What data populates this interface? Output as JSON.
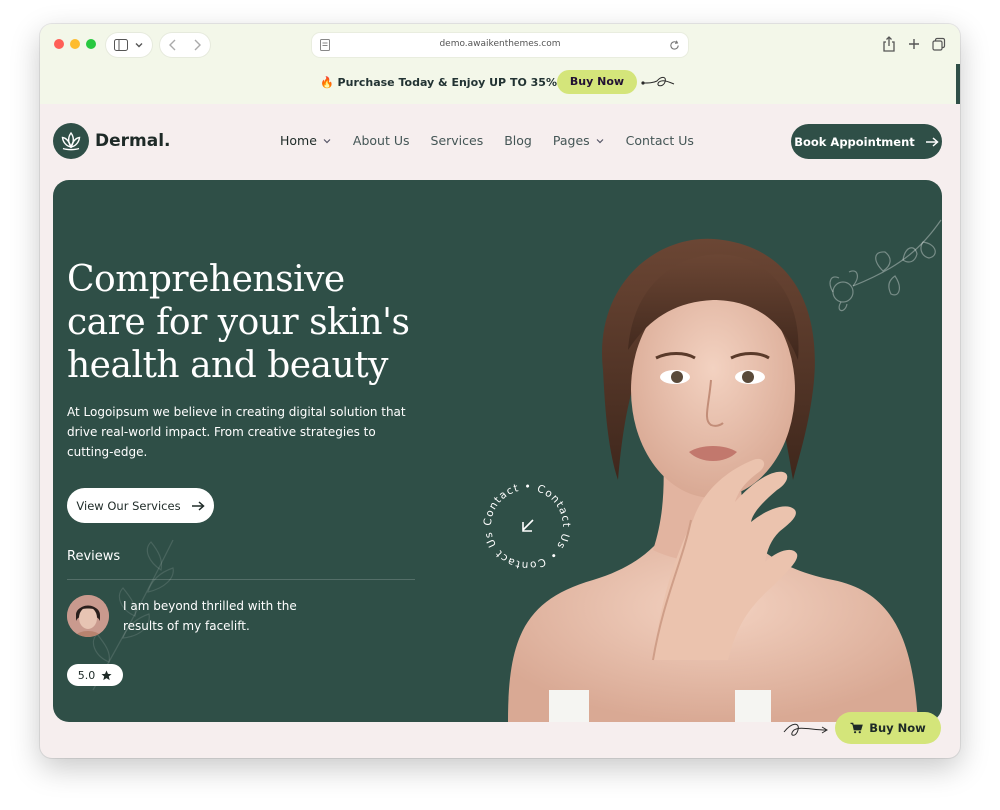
{
  "browser": {
    "url": "demo.awaikenthemes.com"
  },
  "promo": {
    "text": "Purchase Today & Enjoy UP TO 35% Off",
    "button": "Buy Now",
    "icon": "fire-icon"
  },
  "nav": {
    "brand": "Dermal.",
    "items": [
      {
        "label": "Home",
        "has_dropdown": true
      },
      {
        "label": "About Us",
        "has_dropdown": false
      },
      {
        "label": "Services",
        "has_dropdown": false
      },
      {
        "label": "Blog",
        "has_dropdown": false
      },
      {
        "label": "Pages",
        "has_dropdown": true
      },
      {
        "label": "Contact Us",
        "has_dropdown": false
      }
    ],
    "cta": "Book Appointment"
  },
  "hero": {
    "title_lines": [
      "Comprehensive",
      "care for your skin's",
      "health and beauty"
    ],
    "description": "At Logoipsum we believe in creating digital solution that drive real-world impact. From creative strategies to cutting-edge.",
    "button": "View Our Services",
    "reviews_label": "Reviews",
    "review_quote": "I am beyond thrilled with the results of my facelift.",
    "rating": "5.0",
    "contact_badge_text": "Contact • Contact Us • Contact Us •"
  },
  "float_buy": {
    "label": "Buy Now"
  },
  "colors": {
    "primary": "#2f4f47",
    "accent": "#d4e57a",
    "page_bg": "#f6eeee",
    "promo_bg": "#f3f7e9"
  }
}
